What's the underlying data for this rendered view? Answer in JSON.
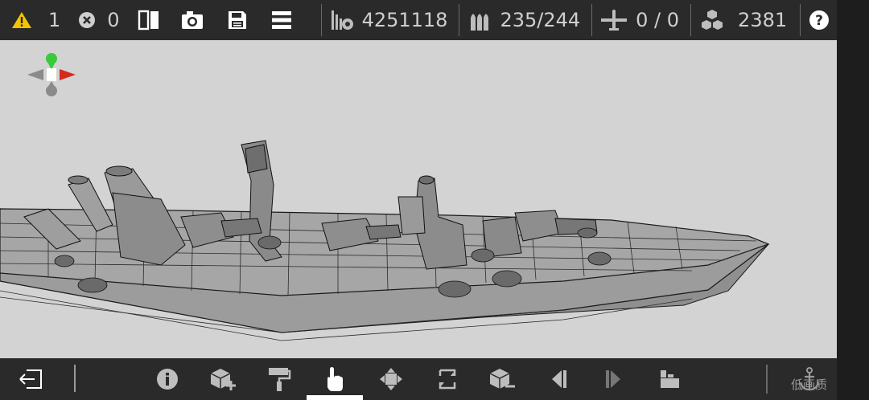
{
  "topbar": {
    "warnings": "1",
    "errors": "0",
    "weight": "4251118",
    "ammo": "235/244",
    "aircraft": "0 / 0",
    "blocks": "2381"
  },
  "watermark": "低画质",
  "colors": {
    "bar_bg": "#2a2a2a",
    "viewport_bg": "#d3d3d3",
    "warning": "#f5c400",
    "gizmo_y": "#3cc83c",
    "gizmo_x": "#d42a1c",
    "gizmo_neutral": "#8a8a8a"
  },
  "icons": {
    "topbar": [
      "warning-icon",
      "error-icon",
      "split-view-icon",
      "camera-icon",
      "save-icon",
      "menu-icon",
      "weight-icon",
      "ammo-icon",
      "aircraft-icon",
      "blocks-icon",
      "help-icon"
    ],
    "bottombar": [
      "exit-icon",
      "info-icon",
      "add-block-icon",
      "paint-roller-icon",
      "touch-select-icon",
      "move-icon",
      "resize-icon",
      "remove-block-icon",
      "step-back-icon",
      "step-forward-icon",
      "place-icon",
      "anchor-icon"
    ]
  }
}
